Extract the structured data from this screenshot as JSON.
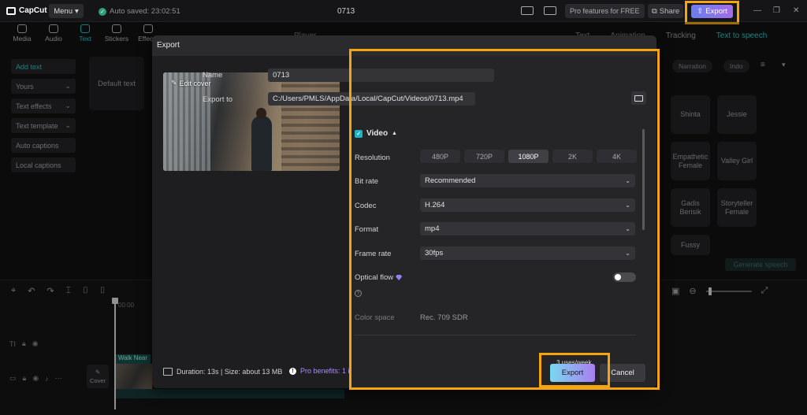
{
  "app": {
    "name": "CapCut",
    "menu_label": "Menu",
    "autosave": "Auto saved: 23:02:51",
    "project_title": "0713"
  },
  "topbar": {
    "pro_free": "Pro features for FREE",
    "share": "Share",
    "export": "Export"
  },
  "tools": [
    "Media",
    "Audio",
    "Text",
    "Stickers",
    "Effects"
  ],
  "active_tool": "Text",
  "side_items": [
    {
      "label": "Add text",
      "active": true,
      "chevron": false
    },
    {
      "label": "Yours",
      "active": false,
      "chevron": true
    },
    {
      "label": "Text effects",
      "active": false,
      "chevron": true
    },
    {
      "label": "Text template",
      "active": false,
      "chevron": true
    },
    {
      "label": "Auto captions",
      "active": false,
      "chevron": false
    },
    {
      "label": "Local captions",
      "active": false,
      "chevron": false
    }
  ],
  "default_text": "Default text",
  "player_label": "Player",
  "right_panel": {
    "tabs": [
      "Text",
      "Animation",
      "Tracking",
      "Text to speech"
    ],
    "active_tab": "Text to speech",
    "chips": [
      "Narration",
      "Indo"
    ],
    "voices": [
      "Shinta",
      "Jessie",
      "Empathetic Female",
      "Valley Girl",
      "Gadis Berisik",
      "Storyteller Female",
      "Fussy"
    ],
    "generate": "Generate speech"
  },
  "timeline": {
    "time_label": "00:00",
    "clip_name": "Walk Near",
    "cover_label": "Cover"
  },
  "dialog": {
    "title": "Export",
    "edit_cover": "Edit cover",
    "duration_info": "Duration: 13s | Size: about 13 MB",
    "pro_benefits": "Pro benefits: 1 item",
    "name_label": "Name",
    "name_value": "0713",
    "export_to_label": "Export to",
    "export_to_value": "C:/Users/PMLS/AppData/Local/CapCut/Videos/0713.mp4",
    "video_label": "Video",
    "resolution_label": "Resolution",
    "resolutions": [
      "480P",
      "720P",
      "1080P",
      "2K",
      "4K"
    ],
    "resolution_selected": "1080P",
    "bitrate_label": "Bit rate",
    "bitrate_value": "Recommended",
    "codec_label": "Codec",
    "codec_value": "H.264",
    "format_label": "Format",
    "format_value": "mp4",
    "framerate_label": "Frame rate",
    "framerate_value": "30fps",
    "optical_flow_label": "Optical flow",
    "colorspace_label": "Color space",
    "colorspace_value": "Rec. 709 SDR",
    "uses_week": "3 uses/week",
    "export_button": "Export",
    "cancel_button": "Cancel"
  },
  "colors": {
    "accent": "#1ec8c8",
    "highlight": "#f5a50f",
    "pro": "#a98cf7"
  }
}
